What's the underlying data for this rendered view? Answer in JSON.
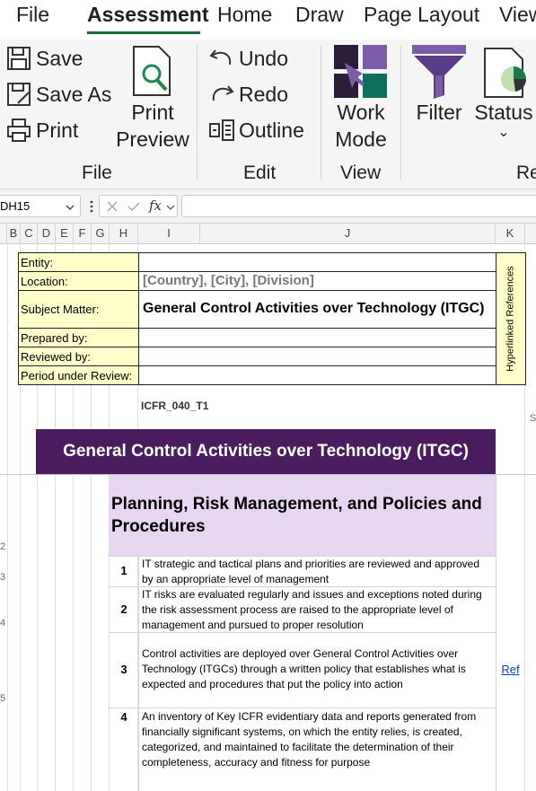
{
  "menu": {
    "items": [
      "File",
      "Assessment",
      "Home",
      "Draw",
      "Page Layout",
      "View"
    ],
    "active": "Assessment"
  },
  "ribbon": {
    "file_group": {
      "save": "Save",
      "save_as": "Save As",
      "print": "Print",
      "print_preview_line1": "Print",
      "print_preview_line2": "Preview",
      "label": "File"
    },
    "edit_group": {
      "undo": "Undo",
      "redo": "Redo",
      "outline": "Outline",
      "label": "Edit"
    },
    "view_group": {
      "work_mode_line1": "Work",
      "work_mode_line2": "Mode",
      "label": "View"
    },
    "filter": "Filter",
    "status": "Status",
    "status_chevron": "⌄",
    "next_group_label": "Re"
  },
  "formula_bar": {
    "name_box": "DH15",
    "formula": "",
    "fx": "fx"
  },
  "columns": [
    "B",
    "C",
    "D",
    "E",
    "F",
    "G",
    "H",
    "I",
    "J",
    "K"
  ],
  "header_table": {
    "rows": [
      {
        "label": "Entity:",
        "value": ""
      },
      {
        "label": "Location:",
        "value": "[Country], [City], [Division]"
      },
      {
        "label": "Subject Matter:",
        "value": "General Control Activities over Technology (ITGC)"
      },
      {
        "label": "Prepared by:",
        "value": ""
      },
      {
        "label": "Reviewed by:",
        "value": ""
      },
      {
        "label": "Period under Review:",
        "value": ""
      }
    ],
    "hyperlinked_references": "Hyperlinked References"
  },
  "doc_code": "ICFR_040_T1",
  "banner_title": "General Control Activities over Technology (ITGC)",
  "section_title": "Planning, Risk Management, and Policies and Procedures",
  "items": [
    {
      "num": "1",
      "text": "IT strategic and tactical plans and priorities are reviewed and approved by an appropriate level of management",
      "ref": ""
    },
    {
      "num": "2",
      "text": "IT risks are evaluated regularly and issues and exceptions noted during the risk assessment process are raised to the appropriate level of management and pursued to proper resolution",
      "ref": ""
    },
    {
      "num": "3",
      "text": "Control activities are deployed over General Control Activities over Technology (ITGCs) through a written policy that establishes what is expected and procedures that put the policy into action",
      "ref": "Ref"
    },
    {
      "num": "4",
      "text": "An inventory of Key ICFR evidentiary data and reports generated from financially significant systems, on which the entity relies, is created, categorized, and maintained to facilitate the determination of their completeness, accuracy and fitness for purpose",
      "ref": ""
    }
  ],
  "row_numbers_partial": [
    "2",
    "3",
    "4",
    "5"
  ],
  "edge_fragment": "S",
  "colors": {
    "banner": "#4b1c5e",
    "section": "#e6d6f2",
    "yellow": "#ffffc9",
    "accent_green": "#1e6b3a",
    "link": "#0b3ecc"
  }
}
